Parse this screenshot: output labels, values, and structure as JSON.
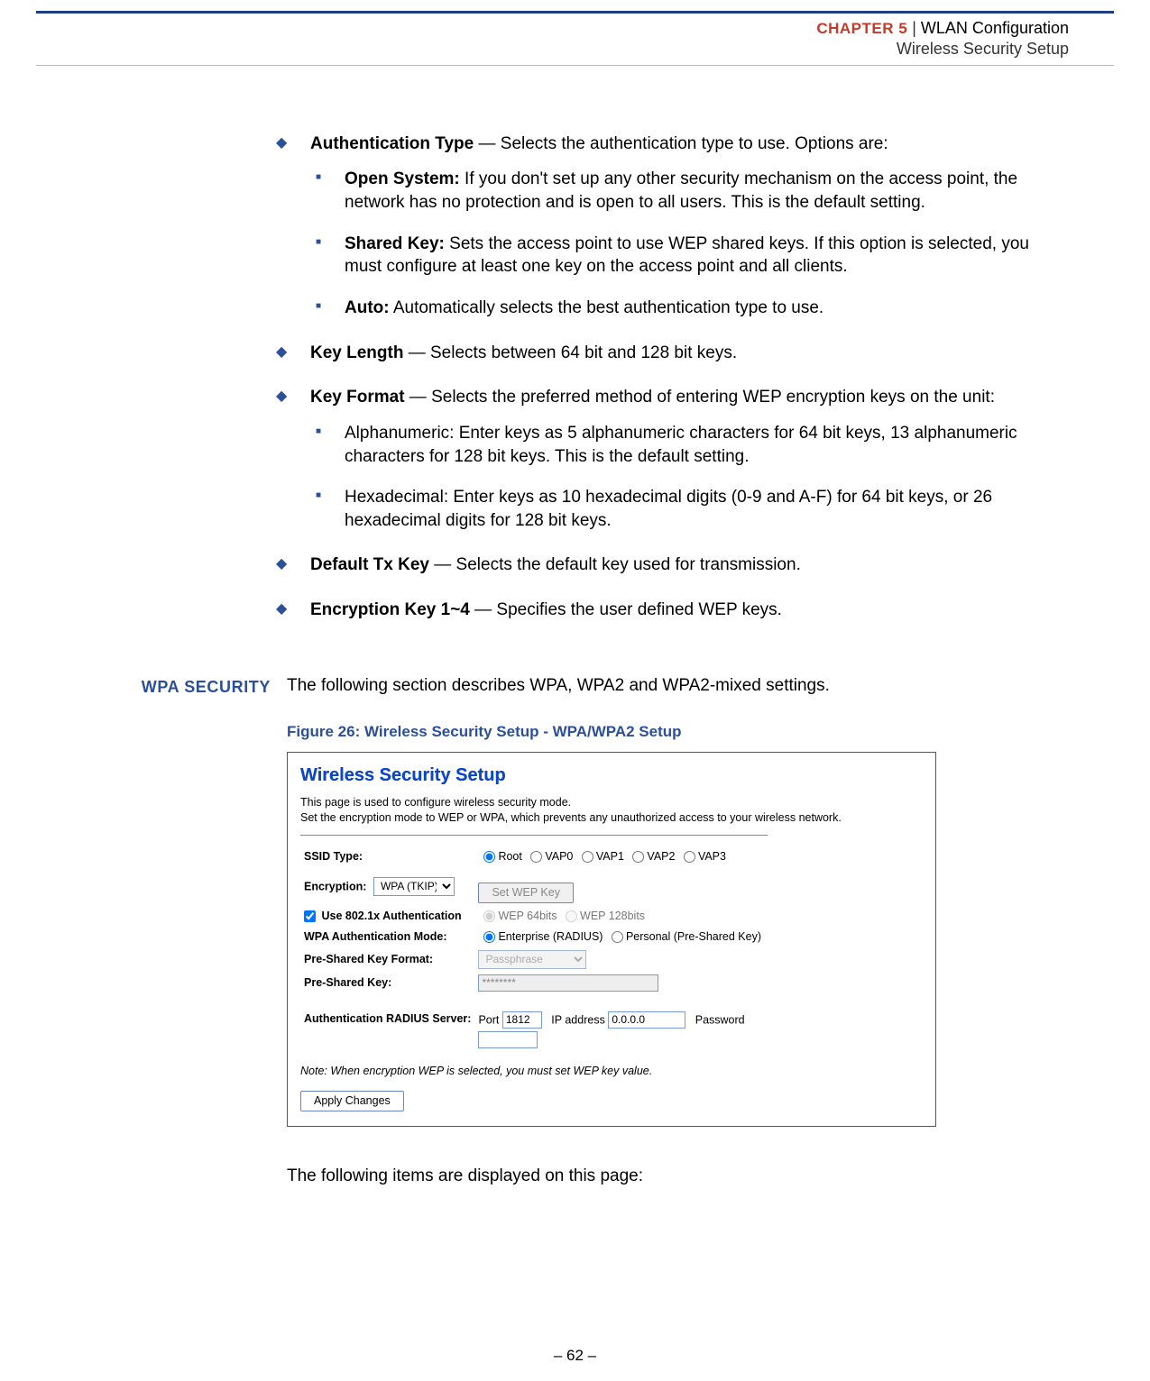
{
  "header": {
    "chapter_label": "CHAPTER 5",
    "separator": "|",
    "chapter_title": "WLAN Configuration",
    "subtitle": "Wireless Security Setup"
  },
  "bullets": {
    "auth_type": {
      "title": "Authentication Type",
      "desc": " — Selects the authentication type to use. Options are:",
      "items": {
        "open": {
          "title": "Open System:",
          "desc": " If you don't set up any other security mechanism on the access point, the network has no protection and is open to all users. This is the default setting."
        },
        "shared": {
          "title": "Shared Key:",
          "desc": " Sets the access point to use WEP shared keys. If this option is selected, you must configure at least one key on the access point and all clients."
        },
        "auto": {
          "title": "Auto:",
          "desc": " Automatically selects the best authentication type to use."
        }
      }
    },
    "key_length": {
      "title": "Key Length",
      "desc": " — Selects between 64 bit and 128 bit keys."
    },
    "key_format": {
      "title": "Key Format",
      "desc": " — Selects the preferred method of entering WEP encryption keys on the unit:",
      "items": {
        "alpha": "Alphanumeric: Enter keys as 5 alphanumeric characters for 64 bit keys, 13 alphanumeric characters for 128 bit keys. This is the default setting.",
        "hex": "Hexadecimal: Enter keys as 10 hexadecimal digits (0-9 and A-F) for 64 bit keys, or 26 hexadecimal digits for 128 bit keys."
      }
    },
    "default_tx": {
      "title": "Default Tx Key",
      "desc": " — Selects the default key used for transmission."
    },
    "enc_key": {
      "title": "Encryption Key 1~4",
      "desc": " — Specifies the user defined WEP keys."
    }
  },
  "section": {
    "side_label": "WPA SECURITY",
    "intro": "The following section describes WPA, WPA2 and WPA2-mixed settings.",
    "figure_caption": "Figure 26:  Wireless Security Setup - WPA/WPA2 Setup"
  },
  "shot": {
    "title": "Wireless Security Setup",
    "desc_line1": "This page is used to configure wireless security mode.",
    "desc_line2": "Set the encryption mode to WEP or WPA, which prevents any unauthorized access to your wireless network.",
    "labels": {
      "ssid_type": "SSID Type:",
      "encryption": "Encryption:",
      "set_wep": "Set WEP Key",
      "use_8021x": "Use 802.1x Authentication",
      "wep64": "WEP 64bits",
      "wep128": "WEP 128bits",
      "wpa_auth_mode": "WPA Authentication Mode:",
      "enterprise": "Enterprise (RADIUS)",
      "personal": "Personal (Pre-Shared Key)",
      "psk_format": "Pre-Shared Key Format:",
      "psk": "Pre-Shared Key:",
      "radius_server": "Authentication RADIUS Server:",
      "port": "Port",
      "ip": "IP address",
      "password": "Password"
    },
    "ssid_options": [
      "Root",
      "VAP0",
      "VAP1",
      "VAP2",
      "VAP3"
    ],
    "encryption_value": "WPA (TKIP)",
    "psk_format_value": "Passphrase",
    "psk_value": "********",
    "port_value": "1812",
    "ip_value": "0.0.0.0",
    "note": "Note: When encryption WEP is selected, you must set WEP key value.",
    "apply_label": "Apply Changes"
  },
  "closing": "The following items are displayed on this page:",
  "footer": {
    "page": "–  62  –"
  }
}
